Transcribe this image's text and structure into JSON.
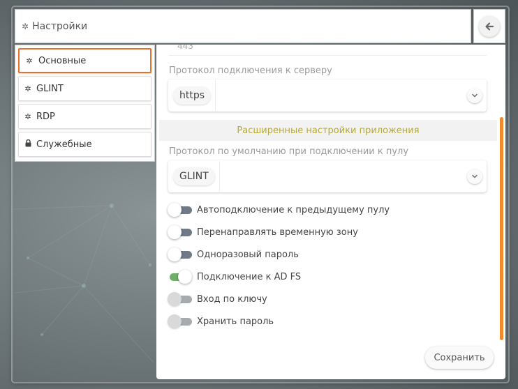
{
  "header": {
    "title": "Настройки",
    "icon": "gear-icon"
  },
  "back_button": {
    "icon": "arrow-left-icon"
  },
  "sidebar": {
    "items": [
      {
        "label": "Основные",
        "icon": "gear-icon",
        "active": true
      },
      {
        "label": "GLINT",
        "icon": "gear-icon",
        "active": false
      },
      {
        "label": "RDP",
        "icon": "gear-icon",
        "active": false
      },
      {
        "label": "Служебные",
        "icon": "lock-icon",
        "active": false
      }
    ]
  },
  "main": {
    "port_value": "443",
    "server_protocol": {
      "label": "Протокол подключения к серверу",
      "value": "https"
    },
    "advanced_section": {
      "title": "Расширенные настройки приложения"
    },
    "pool_protocol": {
      "label": "Протокол по умолчанию при подключении к пулу",
      "value": "GLINT"
    },
    "toggles": [
      {
        "label": "Автоподключение к предыдущему пулу",
        "on": false,
        "disabled": false
      },
      {
        "label": "Перенаправлять временную зону",
        "on": false,
        "disabled": false
      },
      {
        "label": "Одноразовый пароль",
        "on": false,
        "disabled": false
      },
      {
        "label": "Подключение к AD FS",
        "on": true,
        "disabled": false
      },
      {
        "label": "Вход по ключу",
        "on": false,
        "disabled": true
      },
      {
        "label": "Хранить пароль",
        "on": false,
        "disabled": true
      }
    ],
    "save_label": "Сохранить"
  },
  "colors": {
    "accent_orange": "#e86f2c",
    "section_text": "#b5a83d",
    "toggle_on": "#6fae6b",
    "toggle_off": "#6f7a86"
  }
}
